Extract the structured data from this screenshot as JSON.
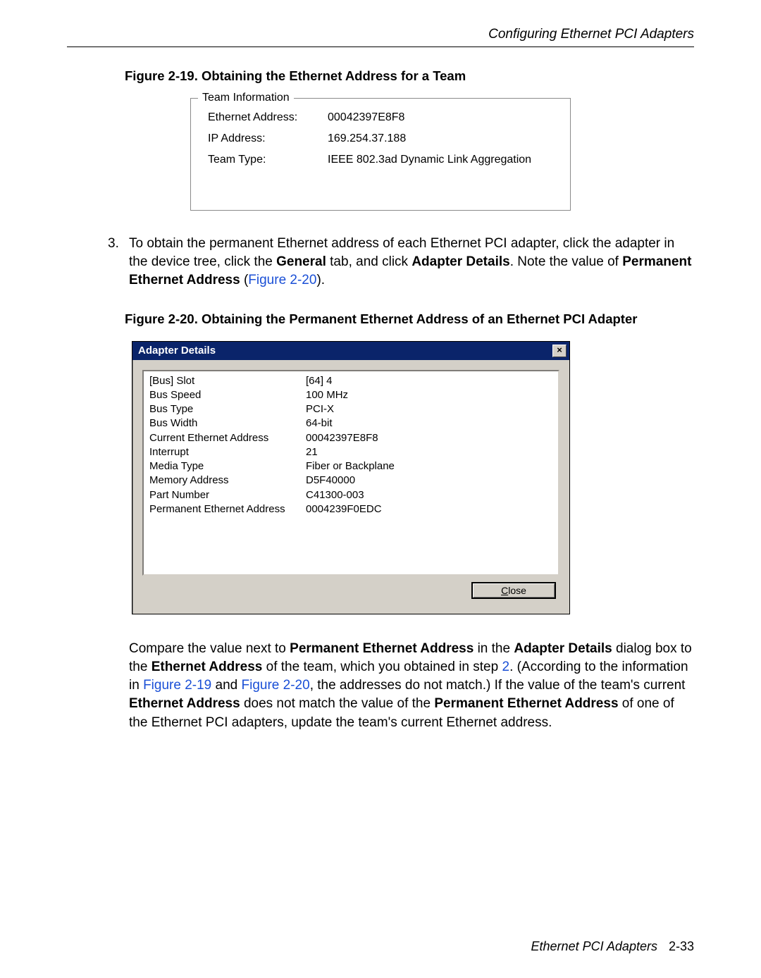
{
  "header": {
    "section_title": "Configuring Ethernet PCI Adapters"
  },
  "figure19": {
    "caption": "Figure 2-19. Obtaining the Ethernet Address for a Team",
    "group_title": "Team Information",
    "rows": [
      {
        "label": "Ethernet Address:",
        "value": "00042397E8F8"
      },
      {
        "label": "IP Address:",
        "value": "169.254.37.188"
      },
      {
        "label": "Team Type:",
        "value": "IEEE 802.3ad Dynamic Link Aggregation"
      }
    ]
  },
  "step3": {
    "number": "3.",
    "line1": "To obtain the permanent Ethernet address of each Ethernet PCI adapter, click the adapter in the device tree, click the ",
    "bold1": "General",
    "mid1": " tab, and click ",
    "bold2": "Adapter Details",
    "mid2": ". Note the value of ",
    "bold3": "Permanent Ethernet Address",
    "mid3": " (",
    "link1": "Figure 2-20",
    "tail": ")."
  },
  "figure20": {
    "caption": "Figure 2-20. Obtaining the Permanent Ethernet Address of an Ethernet PCI Adapter",
    "title": "Adapter Details",
    "close_label": "Close",
    "rows": [
      {
        "key": "[Bus] Slot",
        "value": "[64] 4"
      },
      {
        "key": "Bus Speed",
        "value": "100 MHz"
      },
      {
        "key": "Bus Type",
        "value": "PCI-X"
      },
      {
        "key": "Bus Width",
        "value": "64-bit"
      },
      {
        "key": "Current Ethernet Address",
        "value": "00042397E8F8"
      },
      {
        "key": "Interrupt",
        "value": "21"
      },
      {
        "key": "Media Type",
        "value": "Fiber or Backplane"
      },
      {
        "key": "Memory Address",
        "value": "D5F40000"
      },
      {
        "key": "Part Number",
        "value": "C41300-003"
      },
      {
        "key": "Permanent Ethernet Address",
        "value": "0004239F0EDC"
      }
    ]
  },
  "compare": {
    "t1": "Compare the value next to ",
    "b1": "Permanent Ethernet Address",
    "t2": " in the ",
    "b2": "Adapter Details",
    "t3": " dialog box to the ",
    "b3": "Ethernet Address",
    "t4": " of the team, which you obtained in step ",
    "link_step": "2",
    "t5": ". (According to the information in ",
    "link_f19": "Figure 2-19",
    "t6": " and ",
    "link_f20": "Figure 2-20",
    "t7": ", the addresses do not match.) If the value of the team's current ",
    "b4": "Ethernet Address",
    "t8": " does not match the value of the ",
    "b5": "Permanent Ethernet Address",
    "t9": " of one of the Ethernet PCI adapters, update the team's current Ethernet address."
  },
  "footer": {
    "book": "Ethernet PCI Adapters",
    "page": "2-33"
  }
}
